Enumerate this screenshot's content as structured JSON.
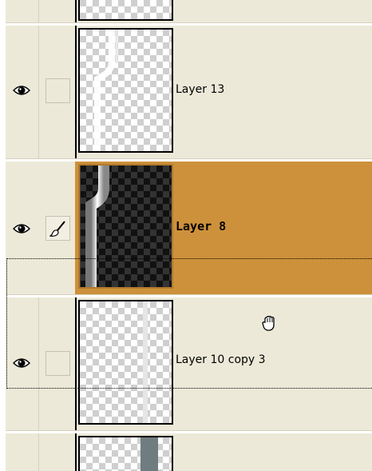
{
  "layers": [
    {
      "name": "",
      "visible": false,
      "state": "partial-top"
    },
    {
      "name": "Layer 13",
      "visible": true,
      "brush": false,
      "selected": false
    },
    {
      "name": "Layer 8",
      "visible": true,
      "brush": true,
      "selected": true
    },
    {
      "name": "Layer 10 copy 3",
      "visible": true,
      "brush": false,
      "selected": false
    },
    {
      "name": "",
      "visible": false,
      "state": "partial-bottom"
    }
  ],
  "colors": {
    "panel": "#ece9d8",
    "selected_row": "#cd913b",
    "border": "#000000"
  },
  "icons": [
    "eye-icon",
    "brush-icon",
    "grab-hand-cursor-icon"
  ]
}
